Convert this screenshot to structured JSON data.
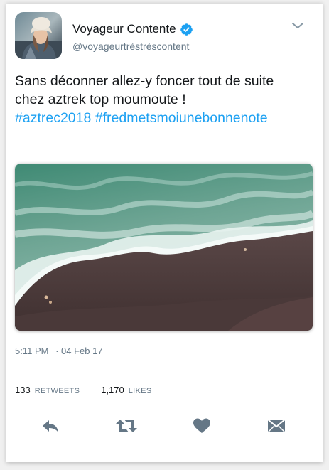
{
  "user": {
    "display_name": "Voyageur Contente",
    "handle": "@voyageurtrèstrèscontent",
    "verified": true
  },
  "tweet": {
    "text_line1": "Sans déconner allez-y foncer tout de suite",
    "text_line2": "chez aztrek top moumoute !",
    "hashtag1": "#aztrec2018",
    "hashtag2": "#fredmetsmoiunebonnenote",
    "time": "5:11 PM",
    "date": "· 04 Feb 17"
  },
  "stats": {
    "retweets_count": "133",
    "retweets_label": "RETWEETS",
    "likes_count": "1,170",
    "likes_label": "LIKES"
  },
  "icons": {
    "verified": "verified-badge-icon",
    "caret": "chevron-down-icon",
    "reply": "reply-icon",
    "retweet": "retweet-icon",
    "like": "heart-icon",
    "message": "envelope-icon"
  },
  "colors": {
    "link": "#1da1f2",
    "icon": "#657786",
    "text": "#14171a",
    "secondary": "#657786"
  }
}
